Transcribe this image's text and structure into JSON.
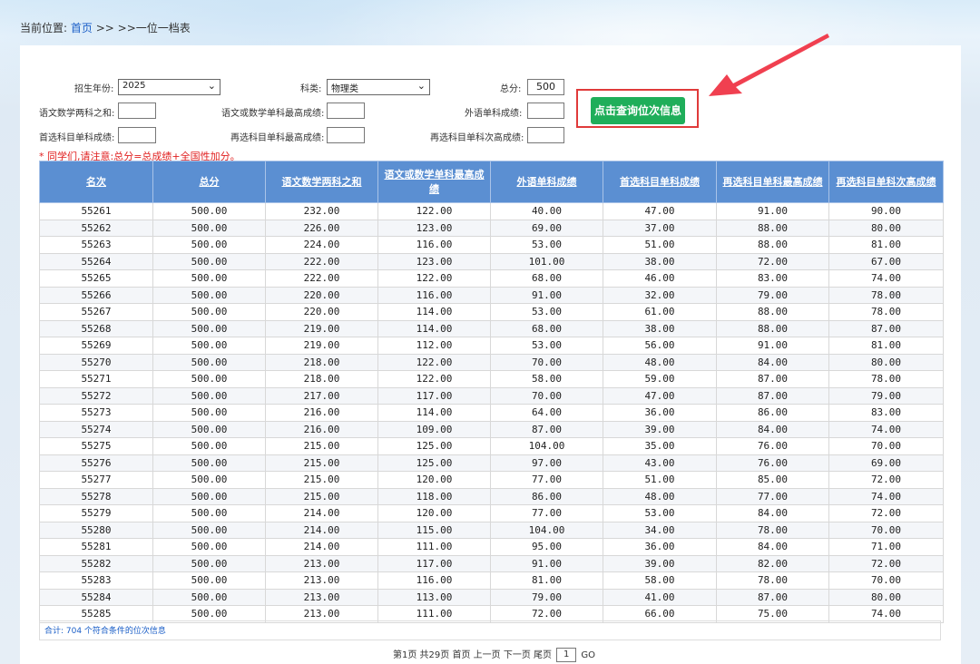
{
  "breadcrumb": {
    "prefix": "当前位置:",
    "home": "首页",
    "sep1": ">>",
    "sep2": ">>",
    "current": "一位一档表"
  },
  "filters": {
    "year_label": "招生年份:",
    "year_value": "2025",
    "subject_label": "科类:",
    "subject_value": "物理类",
    "total_label": "总分:",
    "total_value": "500",
    "chinese_math_sum_label": "语文数学两科之和:",
    "chinese_math_sum_value": "",
    "chinese_math_max_label": "语文或数学单科最高成绩:",
    "chinese_math_max_value": "",
    "foreign_label": "外语单科成绩:",
    "foreign_value": "",
    "first_subject_label": "首选科目单科成绩:",
    "first_subject_value": "",
    "reselect_max_label": "再选科目单科最高成绩:",
    "reselect_max_value": "",
    "reselect_second_label": "再选科目单科次高成绩:",
    "reselect_second_value": ""
  },
  "query_button": "点击查询位次信息",
  "note": "* 同学们,请注意:总分=总成绩+全国性加分。",
  "table": {
    "headers": [
      "名次",
      "总分",
      "语文数学两科之和",
      "语文或数学单科最高成绩",
      "外语单科成绩",
      "首选科目单科成绩",
      "再选科目单科最高成绩",
      "再选科目单科次高成绩"
    ],
    "rows": [
      [
        "55261",
        "500.00",
        "232.00",
        "122.00",
        "40.00",
        "47.00",
        "91.00",
        "90.00"
      ],
      [
        "55262",
        "500.00",
        "226.00",
        "123.00",
        "69.00",
        "37.00",
        "88.00",
        "80.00"
      ],
      [
        "55263",
        "500.00",
        "224.00",
        "116.00",
        "53.00",
        "51.00",
        "88.00",
        "81.00"
      ],
      [
        "55264",
        "500.00",
        "222.00",
        "123.00",
        "101.00",
        "38.00",
        "72.00",
        "67.00"
      ],
      [
        "55265",
        "500.00",
        "222.00",
        "122.00",
        "68.00",
        "46.00",
        "83.00",
        "74.00"
      ],
      [
        "55266",
        "500.00",
        "220.00",
        "116.00",
        "91.00",
        "32.00",
        "79.00",
        "78.00"
      ],
      [
        "55267",
        "500.00",
        "220.00",
        "114.00",
        "53.00",
        "61.00",
        "88.00",
        "78.00"
      ],
      [
        "55268",
        "500.00",
        "219.00",
        "114.00",
        "68.00",
        "38.00",
        "88.00",
        "87.00"
      ],
      [
        "55269",
        "500.00",
        "219.00",
        "112.00",
        "53.00",
        "56.00",
        "91.00",
        "81.00"
      ],
      [
        "55270",
        "500.00",
        "218.00",
        "122.00",
        "70.00",
        "48.00",
        "84.00",
        "80.00"
      ],
      [
        "55271",
        "500.00",
        "218.00",
        "122.00",
        "58.00",
        "59.00",
        "87.00",
        "78.00"
      ],
      [
        "55272",
        "500.00",
        "217.00",
        "117.00",
        "70.00",
        "47.00",
        "87.00",
        "79.00"
      ],
      [
        "55273",
        "500.00",
        "216.00",
        "114.00",
        "64.00",
        "36.00",
        "86.00",
        "83.00"
      ],
      [
        "55274",
        "500.00",
        "216.00",
        "109.00",
        "87.00",
        "39.00",
        "84.00",
        "74.00"
      ],
      [
        "55275",
        "500.00",
        "215.00",
        "125.00",
        "104.00",
        "35.00",
        "76.00",
        "70.00"
      ],
      [
        "55276",
        "500.00",
        "215.00",
        "125.00",
        "97.00",
        "43.00",
        "76.00",
        "69.00"
      ],
      [
        "55277",
        "500.00",
        "215.00",
        "120.00",
        "77.00",
        "51.00",
        "85.00",
        "72.00"
      ],
      [
        "55278",
        "500.00",
        "215.00",
        "118.00",
        "86.00",
        "48.00",
        "77.00",
        "74.00"
      ],
      [
        "55279",
        "500.00",
        "214.00",
        "120.00",
        "77.00",
        "53.00",
        "84.00",
        "72.00"
      ],
      [
        "55280",
        "500.00",
        "214.00",
        "115.00",
        "104.00",
        "34.00",
        "78.00",
        "70.00"
      ],
      [
        "55281",
        "500.00",
        "214.00",
        "111.00",
        "95.00",
        "36.00",
        "84.00",
        "71.00"
      ],
      [
        "55282",
        "500.00",
        "213.00",
        "117.00",
        "91.00",
        "39.00",
        "82.00",
        "72.00"
      ],
      [
        "55283",
        "500.00",
        "213.00",
        "116.00",
        "81.00",
        "58.00",
        "78.00",
        "70.00"
      ],
      [
        "55284",
        "500.00",
        "213.00",
        "113.00",
        "79.00",
        "41.00",
        "87.00",
        "80.00"
      ],
      [
        "55285",
        "500.00",
        "213.00",
        "111.00",
        "72.00",
        "66.00",
        "75.00",
        "74.00"
      ]
    ]
  },
  "total_text": "合计: 704 个符合条件的位次信息",
  "pager": {
    "info": "第1页 共29页",
    "first": "首页",
    "prev": "上一页",
    "next": "下一页",
    "last": "尾页",
    "page_value": "1",
    "go": "GO"
  },
  "colors": {
    "header_bg": "#5b8fd2",
    "button_bg": "#1fae5a",
    "highlight": "#e03a3a",
    "link": "#1a5ec7"
  }
}
